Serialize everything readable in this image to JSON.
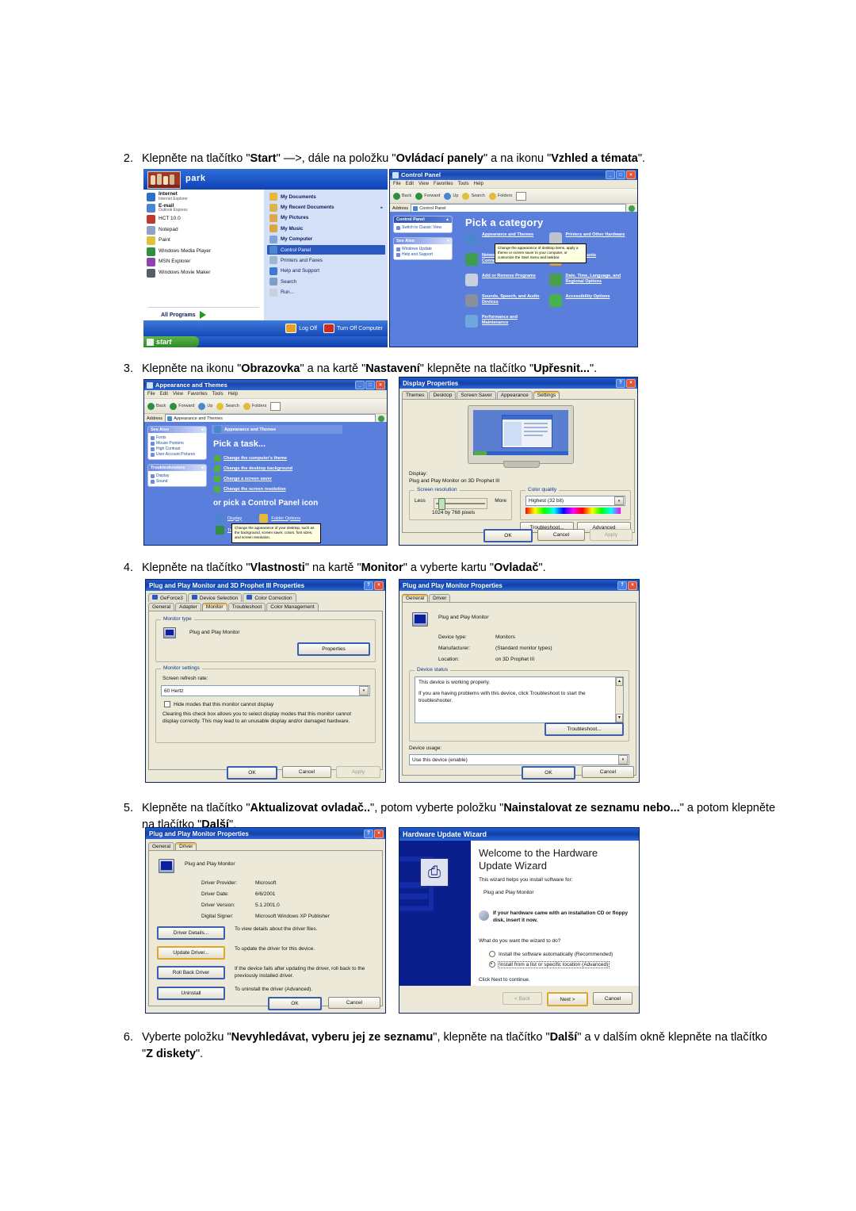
{
  "steps": [
    {
      "num": "2.",
      "parts": [
        {
          "t": "Klepněte na tlačítko \"",
          "b": false
        },
        {
          "t": "Start",
          "b": true
        },
        {
          "t": "\" —>, dále na položku \"",
          "b": false
        },
        {
          "t": "Ovládací panely",
          "b": true
        },
        {
          "t": "\" a na ikonu \"",
          "b": false
        },
        {
          "t": "Vzhled a témata",
          "b": true
        },
        {
          "t": "\".",
          "b": false
        }
      ]
    },
    {
      "num": "3.",
      "parts": [
        {
          "t": "Klepněte na ikonu \"",
          "b": false
        },
        {
          "t": "Obrazovka",
          "b": true
        },
        {
          "t": "\" a na kartě \"",
          "b": false
        },
        {
          "t": "Nastavení",
          "b": true
        },
        {
          "t": "\" klepněte na tlačítko \"",
          "b": false
        },
        {
          "t": "Upřesnit...",
          "b": true
        },
        {
          "t": "\".",
          "b": false
        }
      ]
    },
    {
      "num": "4.",
      "parts": [
        {
          "t": "Klepněte na tlačítko \"",
          "b": false
        },
        {
          "t": "Vlastnosti",
          "b": true
        },
        {
          "t": "\" na kartě \"",
          "b": false
        },
        {
          "t": "Monitor",
          "b": true
        },
        {
          "t": "\" a vyberte kartu \"",
          "b": false
        },
        {
          "t": "Ovladač",
          "b": true
        },
        {
          "t": "\".",
          "b": false
        }
      ]
    },
    {
      "num": "5.",
      "parts": [
        {
          "t": "Klepněte na tlačítko \"",
          "b": false
        },
        {
          "t": "Aktualizovat ovladač..",
          "b": true
        },
        {
          "t": "\", potom vyberte položku \"",
          "b": false
        },
        {
          "t": "Nainstalovat ze seznamu nebo...",
          "b": true
        },
        {
          "t": "\" a potom klepněte na tlačítko \"",
          "b": false
        },
        {
          "t": "Další",
          "b": true
        },
        {
          "t": "\".",
          "b": false
        }
      ]
    },
    {
      "num": "6.",
      "parts": [
        {
          "t": "Vyberte položku \"",
          "b": false
        },
        {
          "t": "Nevyhledávat, vyberu jej ze seznamu",
          "b": true
        },
        {
          "t": "\", klepněte na tlačítko \"",
          "b": false
        },
        {
          "t": "Další",
          "b": true
        },
        {
          "t": "\" a v dalším okně klepněte na tlačítko \"",
          "b": false
        },
        {
          "t": "Z diskety",
          "b": true
        },
        {
          "t": "\".",
          "b": false
        }
      ]
    }
  ],
  "start_menu": {
    "user_name": "park",
    "left_items": [
      {
        "title": "Internet",
        "sub": "Internet Explorer"
      },
      {
        "title": "E-mail",
        "sub": "Outlook Express"
      },
      {
        "title": "HCT 10.0",
        "sub": ""
      },
      {
        "title": "Notepad",
        "sub": ""
      },
      {
        "title": "Paint",
        "sub": ""
      },
      {
        "title": "Windows Media Player",
        "sub": ""
      },
      {
        "title": "MSN Explorer",
        "sub": ""
      },
      {
        "title": "Windows Movie Maker",
        "sub": ""
      }
    ],
    "all_programs": "All Programs",
    "right_items": [
      {
        "label": "My Documents",
        "arrow": false,
        "selected": false
      },
      {
        "label": "My Recent Documents",
        "arrow": true,
        "selected": false
      },
      {
        "label": "My Pictures",
        "arrow": false,
        "selected": false
      },
      {
        "label": "My Music",
        "arrow": false,
        "selected": false
      },
      {
        "label": "My Computer",
        "arrow": false,
        "selected": false
      },
      {
        "label": "Control Panel",
        "arrow": false,
        "selected": true
      },
      {
        "label": "Printers and Faxes",
        "arrow": false,
        "selected": false
      },
      {
        "label": "Help and Support",
        "arrow": false,
        "selected": false
      },
      {
        "label": "Search",
        "arrow": false,
        "selected": false
      },
      {
        "label": "Run...",
        "arrow": false,
        "selected": false
      }
    ],
    "log_off": "Log Off",
    "turn_off": "Turn Off Computer",
    "start_button": "start"
  },
  "control_panel": {
    "title": "Control Panel",
    "menus": [
      "File",
      "Edit",
      "View",
      "Favorites",
      "Tools",
      "Help"
    ],
    "toolbar": [
      "Back",
      "Forward",
      "Up",
      "Search",
      "Folders"
    ],
    "address_label": "Address",
    "address_value": "Control Panel",
    "go_label": "Go",
    "side_title": "Control Panel",
    "side_switch": "Switch to Classic View",
    "see_also_title": "See Also",
    "see_also": [
      "Windows Update",
      "Help and Support"
    ],
    "heading": "Pick a category",
    "categories": [
      {
        "label": "Appearance and Themes",
        "color": "#4d86d0"
      },
      {
        "label": "Printers and Other Hardware",
        "color": "#bcc3cf"
      },
      {
        "label": "Network and Internet Connections",
        "color": "#3f9e4d"
      },
      {
        "label": "User Accounts",
        "color": "#d8a33a"
      },
      {
        "label": "Add or Remove Programs",
        "color": "#c8d0de"
      },
      {
        "label": "Date, Time, Language, and Regional Options",
        "color": "#4aa04a"
      },
      {
        "label": "Sounds, Speech, and Audio Devices",
        "color": "#8a8f99"
      },
      {
        "label": "Accessibility Options",
        "color": "#47b24a"
      },
      {
        "label": "Performance and Maintenance",
        "color": "#6fa8dc"
      }
    ],
    "tooltip": "Change the appearance of desktop items, apply a theme or screen saver to your computer, or customize the Start menu and taskbar."
  },
  "appearance_window": {
    "title": "Appearance and Themes",
    "menus": [
      "File",
      "Edit",
      "View",
      "Favorites",
      "Tools",
      "Help"
    ],
    "address_label": "Address",
    "address_value": "Appearance and Themes",
    "go_label": "Go",
    "see_also_title": "See Also",
    "see_also": [
      "Fonts",
      "Mouse Pointers",
      "High Contrast",
      "User Account Pictures"
    ],
    "troubleshoot_title": "Troubleshooters",
    "troubleshoot": [
      "Display",
      "Sound"
    ],
    "breadcrumb": "Appearance and Themes",
    "task_heading": "Pick a task...",
    "tasks": [
      "Change the computer's theme",
      "Change the desktop background",
      "Change a screen saver",
      "Change the screen resolution"
    ],
    "icon_heading": "or pick a Control Panel icon",
    "icons": [
      "Display",
      "Folder Options",
      "Taskbar and Start Menu"
    ],
    "tooltip": "Change the appearance of your desktop, such as the background, screen saver, colors, font sizes, and screen resolution."
  },
  "display_properties": {
    "title": "Display Properties",
    "tabs": [
      "Themes",
      "Desktop",
      "Screen Saver",
      "Appearance",
      "Settings"
    ],
    "active_tab": "Settings",
    "display_label": "Display:",
    "display_value": "Plug and Play Monitor on 3D Prophet III",
    "resolution_group": "Screen resolution",
    "less": "Less",
    "more": "More",
    "resolution_value": "1024 by 768 pixels",
    "color_group": "Color quality",
    "color_value": "Highest (32 bit)",
    "troubleshoot_btn": "Troubleshoot...",
    "advanced_btn": "Advanced",
    "ok": "OK",
    "cancel": "Cancel",
    "apply": "Apply"
  },
  "monitor_props": {
    "title": "Plug and Play Monitor and 3D Prophet III Properties",
    "tabs_row1": [
      "GeForce3",
      "Device Selection",
      "Color Correction"
    ],
    "tabs_row2": [
      "General",
      "Adapter",
      "Monitor",
      "Troubleshoot",
      "Color Management"
    ],
    "active_tab": "Monitor",
    "type_group": "Monitor type",
    "monitor_name": "Plug and Play Monitor",
    "properties_btn": "Properties",
    "settings_group": "Monitor settings",
    "refresh_label": "Screen refresh rate:",
    "refresh_value": "60 Hertz",
    "hide_modes": "Hide modes that this monitor cannot display",
    "hide_desc": "Clearing this check box allows you to select display modes that this monitor cannot display correctly. This may lead to an unusable display and/or damaged hardware.",
    "ok": "OK",
    "cancel": "Cancel",
    "apply": "Apply"
  },
  "pnp_general": {
    "title": "Plug and Play Monitor Properties",
    "tabs": [
      "General",
      "Driver"
    ],
    "active_tab": "General",
    "device_name": "Plug and Play Monitor",
    "rows": [
      {
        "k": "Device type:",
        "v": "Monitors"
      },
      {
        "k": "Manufacturer:",
        "v": "(Standard monitor types)"
      },
      {
        "k": "Location:",
        "v": "on 3D Prophet III"
      }
    ],
    "status_group": "Device status",
    "status_line1": "This device is working properly.",
    "status_line2": "If you are having problems with this device, click Troubleshoot to start the troubleshooter.",
    "troubleshoot_btn": "Troubleshoot...",
    "usage_label": "Device usage:",
    "usage_value": "Use this device (enable)",
    "ok": "OK",
    "cancel": "Cancel"
  },
  "pnp_driver": {
    "title": "Plug and Play Monitor Properties",
    "tabs": [
      "General",
      "Driver"
    ],
    "active_tab": "Driver",
    "device_name": "Plug and Play Monitor",
    "rows": [
      {
        "k": "Driver Provider:",
        "v": "Microsoft"
      },
      {
        "k": "Driver Date:",
        "v": "6/6/2001"
      },
      {
        "k": "Driver Version:",
        "v": "5.1.2001.0"
      },
      {
        "k": "Digital Signer:",
        "v": "Microsoft Windows XP Publisher"
      }
    ],
    "buttons": [
      {
        "label": "Driver Details...",
        "desc": "To view details about the driver files.",
        "highlight": false
      },
      {
        "label": "Update Driver...",
        "desc": "To update the driver for this device.",
        "highlight": true
      },
      {
        "label": "Roll Back Driver",
        "desc": "If the device fails after updating the driver, roll back to the previously installed driver.",
        "highlight": false
      },
      {
        "label": "Uninstall",
        "desc": "To uninstall the driver (Advanced).",
        "highlight": false
      }
    ],
    "ok": "OK",
    "cancel": "Cancel"
  },
  "wizard": {
    "title": "Hardware Update Wizard",
    "heading": "Welcome to the Hardware Update Wizard",
    "intro": "This wizard helps you install software for:",
    "device": "Plug and Play Monitor",
    "cd_note": "If your hardware came with an installation CD or floppy disk, insert it now.",
    "question": "What do you want the wizard to do?",
    "options": [
      {
        "label": "Install the software automatically (Recommended)",
        "selected": false
      },
      {
        "label": "Install from a list or specific location (Advanced)",
        "selected": true
      }
    ],
    "continue": "Click Next to continue.",
    "back": "< Back",
    "next": "Next >",
    "cancel": "Cancel"
  }
}
